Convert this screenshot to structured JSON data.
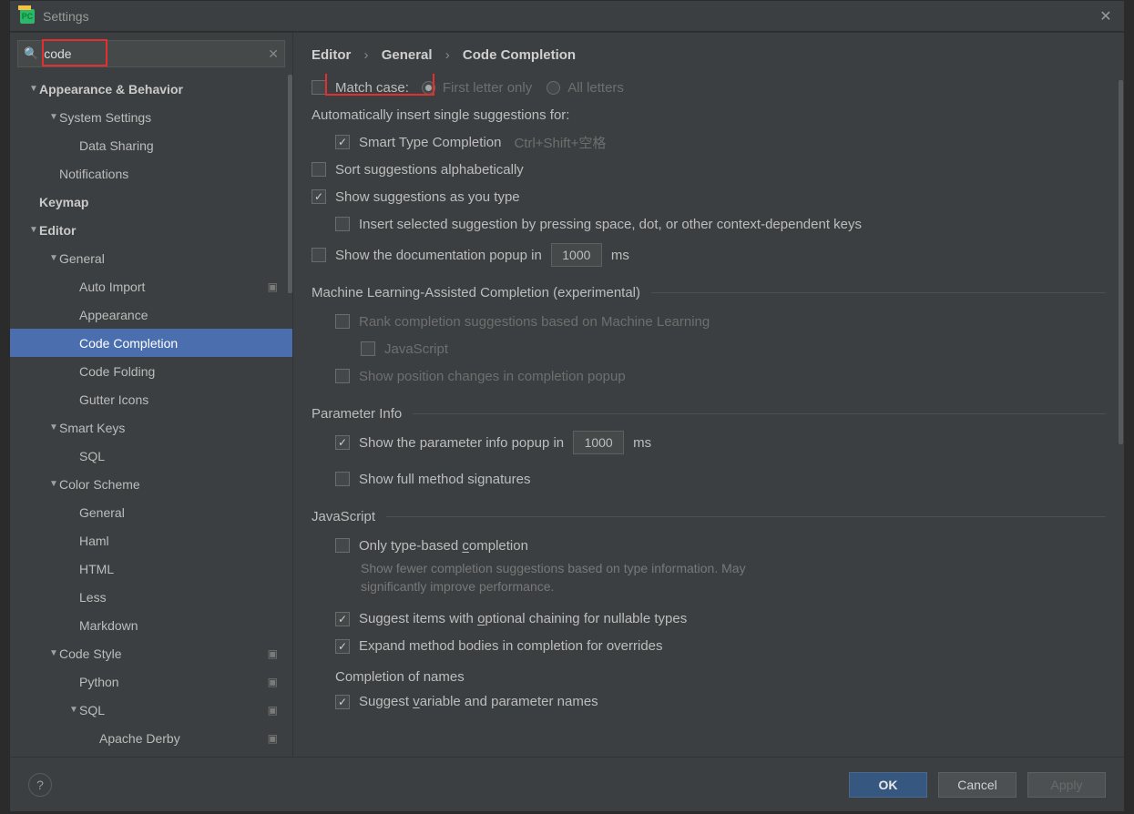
{
  "window": {
    "title": "Settings"
  },
  "search": {
    "value": "code"
  },
  "sidebar": {
    "items": [
      {
        "label": "Appearance & Behavior",
        "indent": 0,
        "arrow": "▼",
        "bold": true
      },
      {
        "label": "System Settings",
        "indent": 1,
        "arrow": "▼"
      },
      {
        "label": "Data Sharing",
        "indent": 2
      },
      {
        "label": "Notifications",
        "indent": 1
      },
      {
        "label": "Keymap",
        "indent": 0,
        "bold": true
      },
      {
        "label": "Editor",
        "indent": 0,
        "arrow": "▼",
        "bold": true
      },
      {
        "label": "General",
        "indent": 1,
        "arrow": "▼"
      },
      {
        "label": "Auto Import",
        "indent": 2,
        "badge": "▣"
      },
      {
        "label": "Appearance",
        "indent": 2
      },
      {
        "label": "Code Completion",
        "indent": 2,
        "selected": true
      },
      {
        "label": "Code Folding",
        "indent": 2
      },
      {
        "label": "Gutter Icons",
        "indent": 2
      },
      {
        "label": "Smart Keys",
        "indent": 1,
        "arrow": "▼"
      },
      {
        "label": "SQL",
        "indent": 2
      },
      {
        "label": "Color Scheme",
        "indent": 1,
        "arrow": "▼"
      },
      {
        "label": "General",
        "indent": 2
      },
      {
        "label": "Haml",
        "indent": 2
      },
      {
        "label": "HTML",
        "indent": 2
      },
      {
        "label": "Less",
        "indent": 2
      },
      {
        "label": "Markdown",
        "indent": 2
      },
      {
        "label": "Code Style",
        "indent": 1,
        "arrow": "▼",
        "badge": "▣"
      },
      {
        "label": "Python",
        "indent": 2,
        "badge": "▣"
      },
      {
        "label": "SQL",
        "indent": 2,
        "arrow": "▼",
        "badge": "▣"
      },
      {
        "label": "Apache Derby",
        "indent": 3,
        "badge": "▣"
      }
    ]
  },
  "breadcrumb": {
    "a": "Editor",
    "b": "General",
    "c": "Code Completion"
  },
  "content": {
    "matchCase": "Match case:",
    "firstLetter": "First letter only",
    "allLetters": "All letters",
    "autoInsertHeader": "Automatically insert single suggestions for:",
    "smartType": "Smart Type Completion",
    "smartTypeShortcut": "Ctrl+Shift+空格",
    "sortAlpha": "Sort suggestions alphabetically",
    "showAsType": "Show suggestions as you type",
    "insertBySpace": "Insert selected suggestion by pressing space, dot, or other context-dependent keys",
    "showDoc1": "Show the documentation popup in",
    "docMs": "1000",
    "msLabel": "ms",
    "mlHeader": "Machine Learning-Assisted Completion (experimental)",
    "rankML": "Rank completion suggestions based on Machine Learning",
    "jsLang": "JavaScript",
    "showPos": "Show position changes in completion popup",
    "paramHeader": "Parameter Info",
    "showParam": "Show the parameter info popup in",
    "paramMs": "1000",
    "showFull": "Show full method signatures",
    "jsHeader": "JavaScript",
    "onlyTypePre": "Only type-based ",
    "onlyTypeU": "c",
    "onlyTypePost": "ompletion",
    "onlyTypeHint": "Show fewer completion suggestions based on type information. May significantly improve performance.",
    "suggestOptPre": "Suggest items with ",
    "suggestOptU": "o",
    "suggestOptPost": "ptional chaining for nullable types",
    "expandBodies": "Expand method bodies in completion for overrides",
    "completionNames": "Completion of names",
    "suggestVarPre": "Suggest ",
    "suggestVarU": "v",
    "suggestVarPost": "ariable and parameter names"
  },
  "footer": {
    "ok": "OK",
    "cancel": "Cancel",
    "apply": "Apply"
  }
}
